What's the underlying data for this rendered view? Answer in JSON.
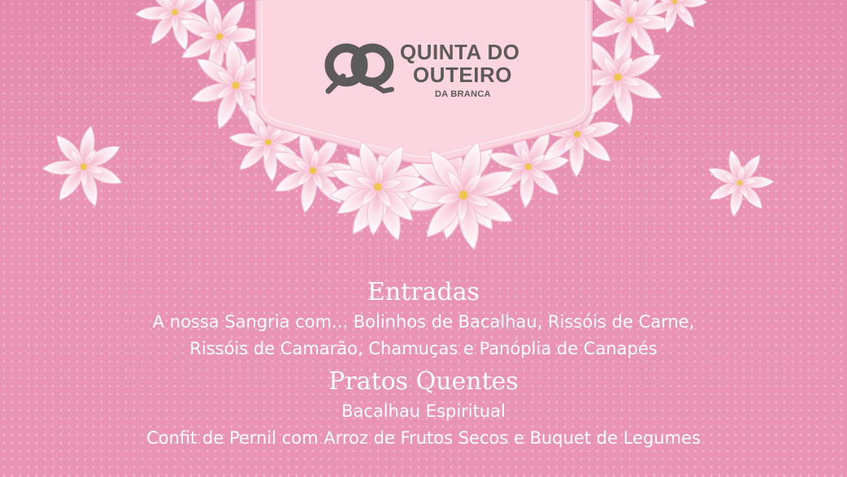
{
  "logo": {
    "line1": "QUINTA DO",
    "line2": "OUTEIRO",
    "sub": "DA BRANCA"
  },
  "menu": {
    "sections": [
      {
        "title": "Entradas",
        "items": [
          "A nossa Sangria com... Bolinhos de Bacalhau, Rissóis de Carne,",
          "Rissóis de Camarão, Chamuças e Panóplia de Canapés"
        ]
      },
      {
        "title": "Pratos Quentes",
        "items": [
          "Bacalhau Espiritual",
          "Confit de Pernil com Arroz de Frutos Secos e Buquet de Legumes"
        ]
      }
    ]
  },
  "colors": {
    "background": "#e994b5",
    "banner": "#fbd5df",
    "logo": "#5d5a5c",
    "text": "#ffffff",
    "petal": "#fdebf1"
  }
}
